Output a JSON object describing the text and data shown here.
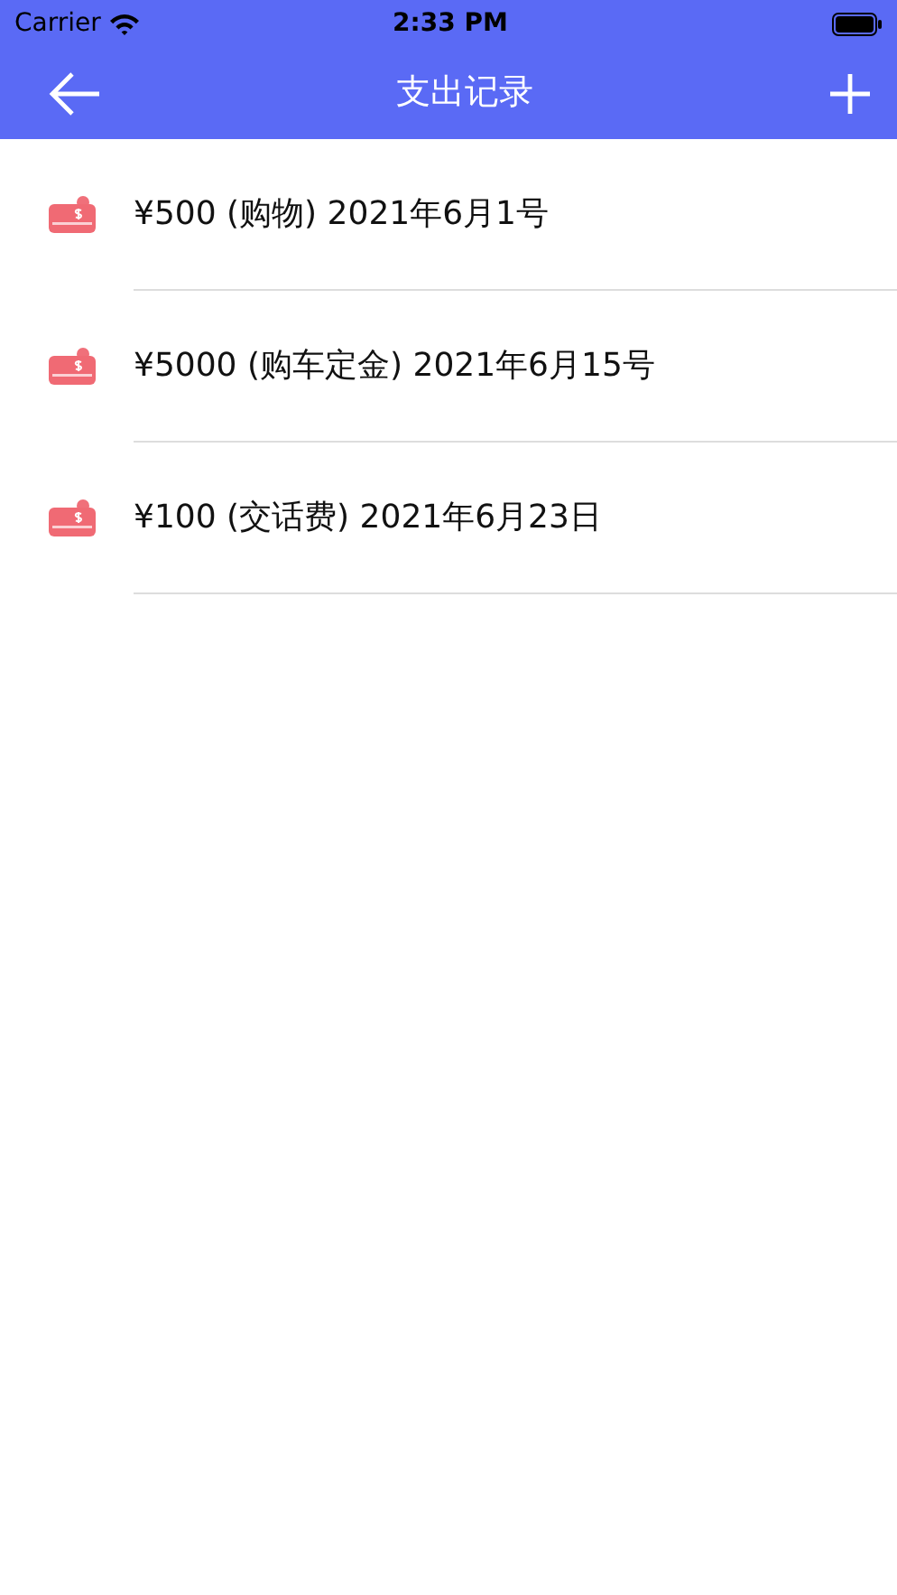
{
  "status_bar": {
    "carrier": "Carrier",
    "time": "2:33 PM"
  },
  "nav_bar": {
    "title": "支出记录"
  },
  "records": [
    {
      "text": "¥500 (购物) 2021年6月1号"
    },
    {
      "text": "¥5000 (购车定金) 2021年6月15号"
    },
    {
      "text": "¥100 (交话费) 2021年6月23日"
    }
  ]
}
